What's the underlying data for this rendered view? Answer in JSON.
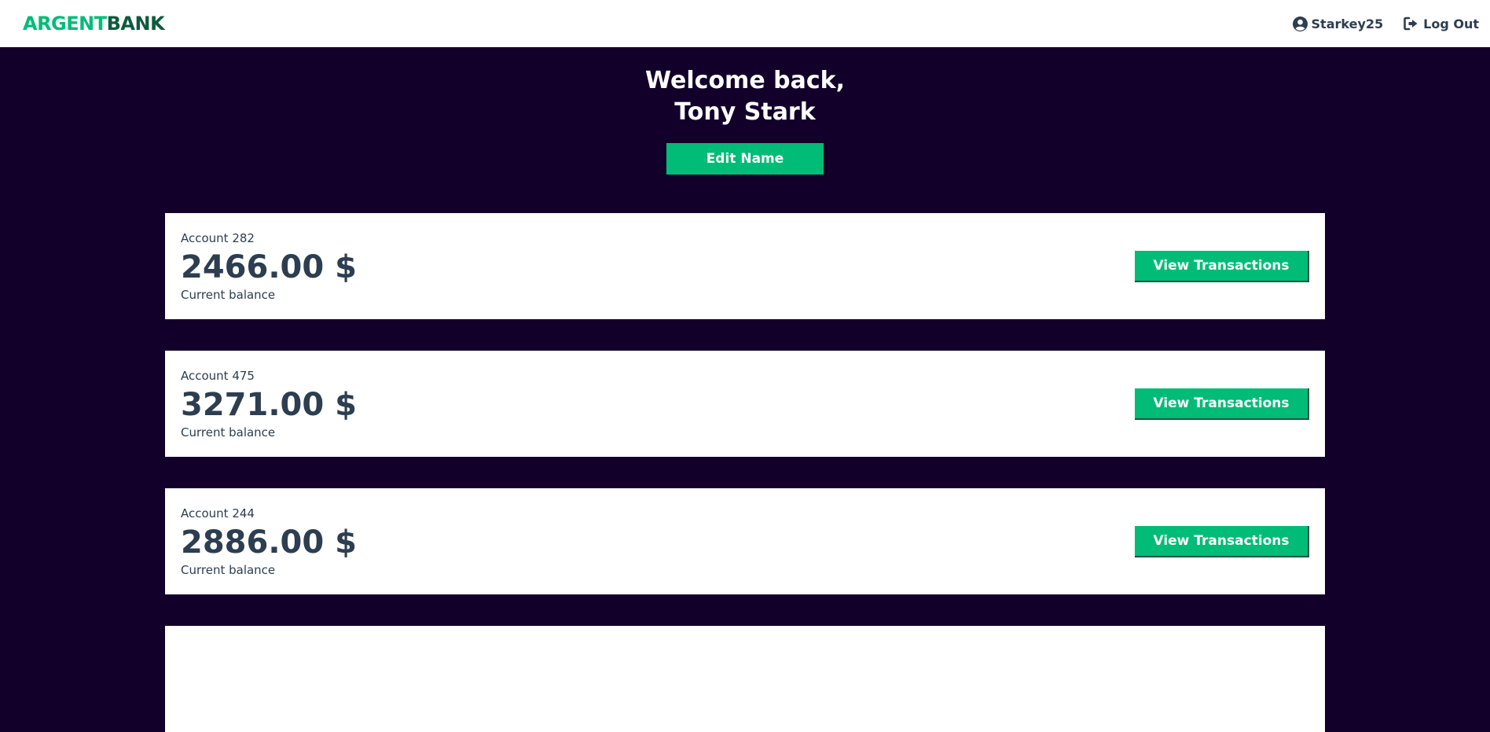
{
  "brand": {
    "part1": "ARGENT",
    "part2": "BANK"
  },
  "nav": {
    "user_label": "Starkey25",
    "logout_label": "Log Out"
  },
  "header": {
    "line1": "Welcome back,",
    "line2": "Tony Stark",
    "edit_label": "Edit Name"
  },
  "accounts": [
    {
      "title": "Account 282",
      "amount": "2466.00 $",
      "description": "Current balance",
      "button": "View Transactions"
    },
    {
      "title": "Account 475",
      "amount": "3271.00 $",
      "description": "Current balance",
      "button": "View Transactions"
    },
    {
      "title": "Account 244",
      "amount": "2886.00 $",
      "description": "Current balance",
      "button": "View Transactions"
    },
    {
      "title": "",
      "amount": "",
      "description": "",
      "button": ""
    }
  ],
  "colors": {
    "accent": "#00bc77",
    "brand_dark": "#0e5a3f",
    "background": "#12002b",
    "text": "#2c3e50"
  },
  "icons": {
    "user": "user-circle-icon",
    "logout": "sign-out-icon"
  }
}
